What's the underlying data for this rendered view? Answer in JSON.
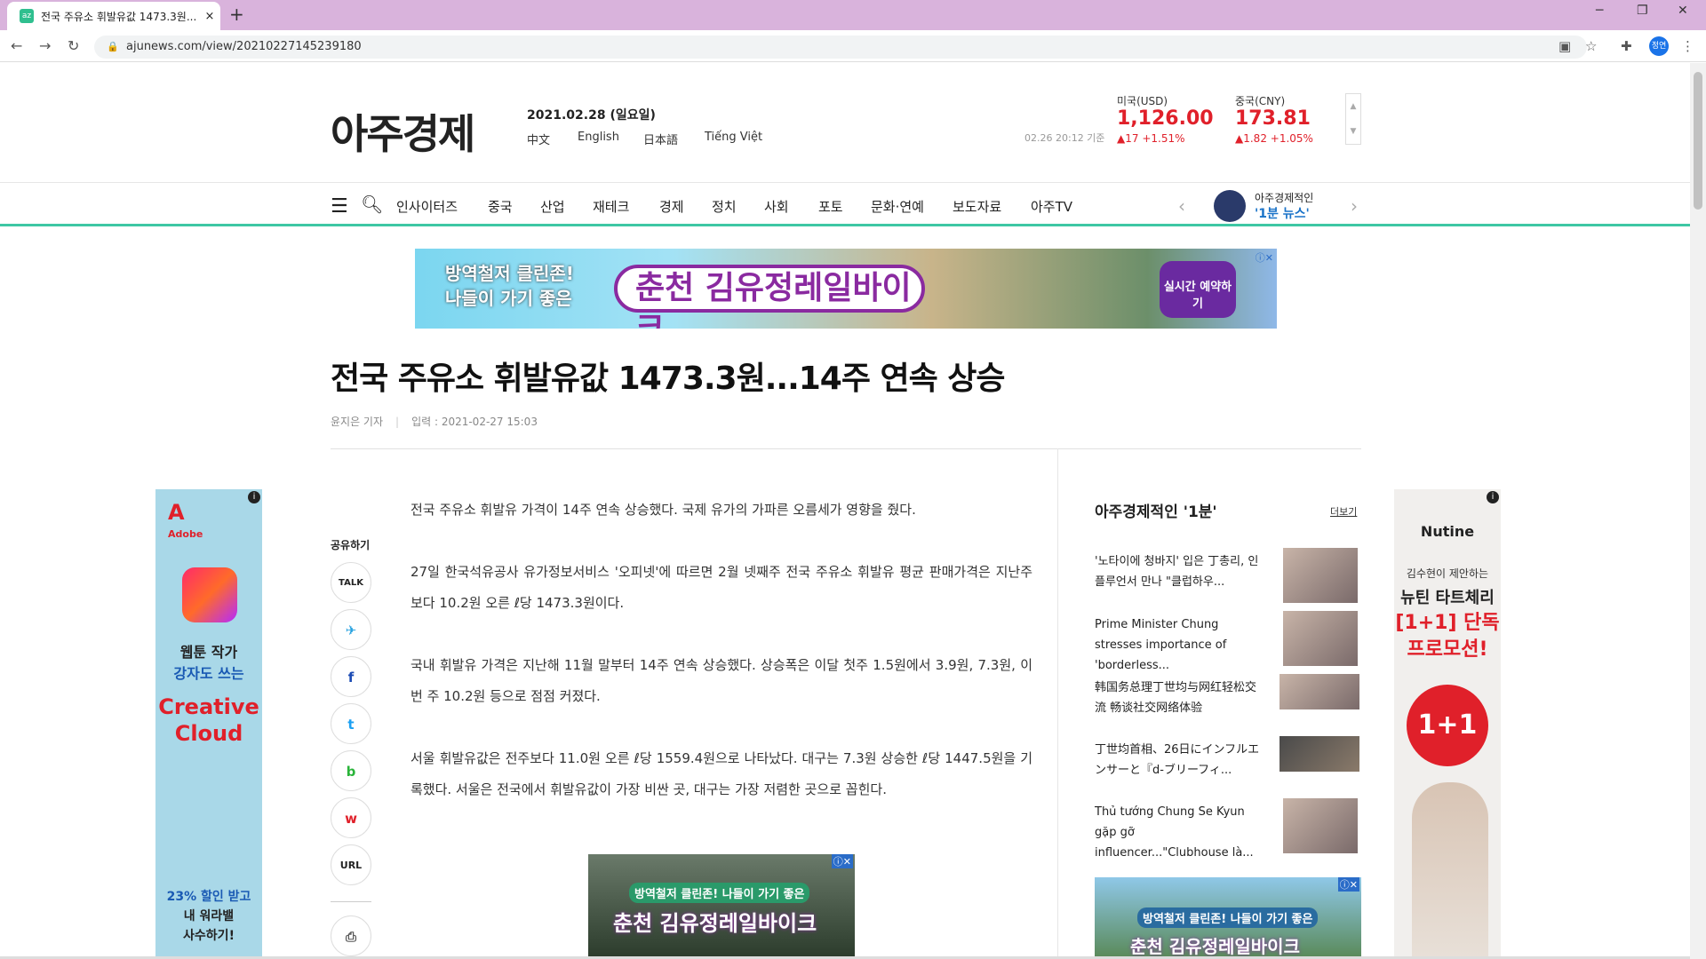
{
  "browser": {
    "tab_title": "전국 주유소 휘발유값 1473.3원...",
    "tab_close": "×",
    "new_tab": "+",
    "url": "ajunews.com/view/20210227145239180",
    "profile": "정연"
  },
  "header": {
    "logo": "아주경제",
    "date": "2021.02.28 (일요일)",
    "languages": [
      "中文",
      "English",
      "日本語",
      "Tiếng Việt"
    ],
    "fx_stamp": "02.26 20:12 기준",
    "fx": [
      {
        "label": "미국(USD)",
        "value": "1,126.00",
        "change": "▲17  +1.51%"
      },
      {
        "label": "중국(CNY)",
        "value": "173.81",
        "change": "▲1.82  +1.05%"
      }
    ]
  },
  "nav": {
    "items": [
      "인사이터즈",
      "중국",
      "산업",
      "재테크",
      "경제",
      "정치",
      "사회",
      "포토",
      "문화·연예",
      "보도자료",
      "아주TV"
    ],
    "one_min_line1": "아주경제적인",
    "one_min_line2": "'1분 뉴스'"
  },
  "top_ad": {
    "text1a": "방역철저 클린존!",
    "text1b": "나들이 가기 좋은",
    "text2": "춘천 김유정레일바이크",
    "text3": "실시간 예약하기"
  },
  "article": {
    "title": "전국 주유소 휘발유값 1473.3원...14주 연속 상승",
    "author": "윤지은 기자",
    "published": "입력 : 2021-02-27 15:03",
    "paragraphs": [
      "전국 주유소 휘발유 가격이 14주 연속 상승했다. 국제 유가의 가파른 오름세가 영향을 줬다.",
      "27일 한국석유공사 유가정보서비스 '오피넷'에 따르면 2월 넷째주 전국 주유소 휘발유 평균 판매가격은 지난주보다 10.2원 오른 ℓ당 1473.3원이다.",
      "국내 휘발유 가격은 지난해 11월 말부터 14주 연속 상승했다. 상승폭은 이달 첫주 1.5원에서 3.9원, 7.3원, 이번 주 10.2원 등으로 점점 커졌다.",
      "서울 휘발유값은 전주보다 11.0원 오른 ℓ당 1559.4원으로 나타났다. 대구는 7.3원 상승한 ℓ당 1447.5원을 기록했다. 서울은 전국에서 휘발유값이 가장 비싼 곳, 대구는 가장 저렴한 곳으로 꼽힌다."
    ]
  },
  "share": {
    "label": "공유하기",
    "buttons": [
      "TALK",
      "✈",
      "f",
      "t",
      "b",
      "w",
      "URL",
      "⎙"
    ]
  },
  "mid_ad": {
    "text1": "방역철저 클린존! 나들이 가기 좋은",
    "text2": "춘천 김유정레일바이크"
  },
  "sidebar": {
    "title": "아주경제적인 '1분'",
    "more": "더보기",
    "items": [
      "'노타이에 청바지' 입은 丁총리, 인플루언서 만나 \"클럽하우...",
      "Prime Minister Chung stresses importance of 'borderless...",
      "韩国务总理丁世均与网红轻松交流 畅谈社交网络体验",
      "丁世均首相、26日にインフルエンサーと『d-ブリーフィ...",
      "Thủ tướng Chung Se Kyun gặp gỡ influencer...\"Clubhouse là..."
    ],
    "ad_text1": "방역철저 클린존! 나들이 가기 좋은",
    "ad_text2": "춘천 김유정레일바이크"
  },
  "left_ad": {
    "brand": "Adobe",
    "line1a": "웹툰 작가",
    "line1b": "강자도 쓰는",
    "line2": "Creative Cloud",
    "line3a": "23% 할인 받고",
    "line3b": "내 워라밸",
    "line3c": "사수하기!"
  },
  "right_ad": {
    "brand": "Nutine",
    "line1": "김수현이 제안하는",
    "line2": "뉴틴 타트체리",
    "line3": "[1+1] 단독 프로모션!",
    "badge": "1+1"
  },
  "colors": {
    "accent": "#3ec7a4",
    "fx_red": "#e0202a",
    "tab_bar": "#d9b3dc"
  }
}
